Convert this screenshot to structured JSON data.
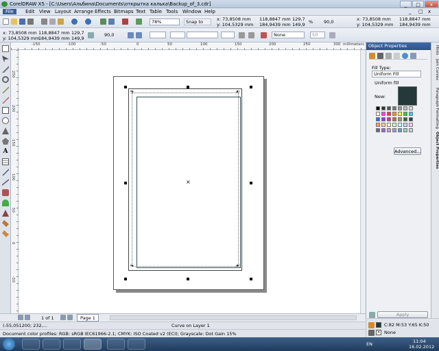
{
  "window": {
    "title": "CorelDRAW X5 - [C:\\Users\\Альбина\\Documents\\открытка калька\\Backup_of_3.cdr]",
    "min_label": "_",
    "max_label": "□",
    "close_label": "x",
    "sub_min_label": "_",
    "sub_max_label": "□",
    "sub_close_label": "x"
  },
  "menu": [
    "File",
    "Edit",
    "View",
    "Layout",
    "Arrange",
    "Effects",
    "Bitmaps",
    "Text",
    "Table",
    "Tools",
    "Window",
    "Help"
  ],
  "standard_toolbar": {
    "zoom": "78%",
    "snap_to": "Snap to",
    "x": "x: 73,8508 mm",
    "y": "y: 104,5329 mm",
    "w": "118,8847 mm",
    "h": "184,9439 mm",
    "scale_w": "129,7",
    "scale_h": "149,9",
    "pct": "%",
    "angle": "90,0",
    "right_x": "x: 73,8508 mm",
    "right_y": "y: 104,5329 mm",
    "right_w": "118,8847 mm",
    "right_h": "184,9439 mm",
    "right_scale_w": "129,7",
    "right_scale_h": "149,9",
    "right_angle": "90,0"
  },
  "property_bar": {
    "x": "x: 73,8508 mm",
    "y": "y: 104,5329 mm",
    "w": "118,8847 mm",
    "h": "184,9439 mm",
    "scale_w": "129,7",
    "scale_h": "149,9",
    "angle": "90,0",
    "outline": "None",
    "step": "50"
  },
  "ruler": {
    "units": "millimeters",
    "h_ticks": [
      "-150",
      "-100",
      "-50",
      "0",
      "50",
      "100",
      "150",
      "200",
      "250",
      "300"
    ],
    "v_ticks": [
      "250",
      "200",
      "150",
      "100",
      "50",
      "0",
      "-50"
    ]
  },
  "docker": {
    "title": "Object Properties",
    "fill_type_label": "Fill Type:",
    "fill_type_value": "Uniform Fill",
    "uniform_fill": "Uniform fill",
    "new_label": "New:",
    "new_color": "#23393a",
    "advanced": "Advanced...",
    "apply": "Apply"
  },
  "dock_tabs": [
    "Hints",
    "Join Curves",
    "Paragraph Formatting",
    "Object Properties"
  ],
  "page_bar": {
    "page_counter": "1 of 1",
    "page_tab": "Page 1"
  },
  "status": {
    "coords": "(-55,051200; 232,...",
    "object_info": "Curve on Layer 1",
    "color_profiles": "Document color profiles: RGB: sRGB IEC61966-2.1; CMYK: ISO Coated v2 (ECI); Grayscale: Dot Gain 15%",
    "fill_info": "C:82 M:53 Y:65 K:50",
    "outline_info": "None",
    "fill_color": "#23393a"
  },
  "taskbar": {
    "lang": "EN",
    "time": "11:04",
    "date": "16.02.2012"
  },
  "colors": {
    "accent": "#3a5f96",
    "frame": "#2f4f4f"
  }
}
